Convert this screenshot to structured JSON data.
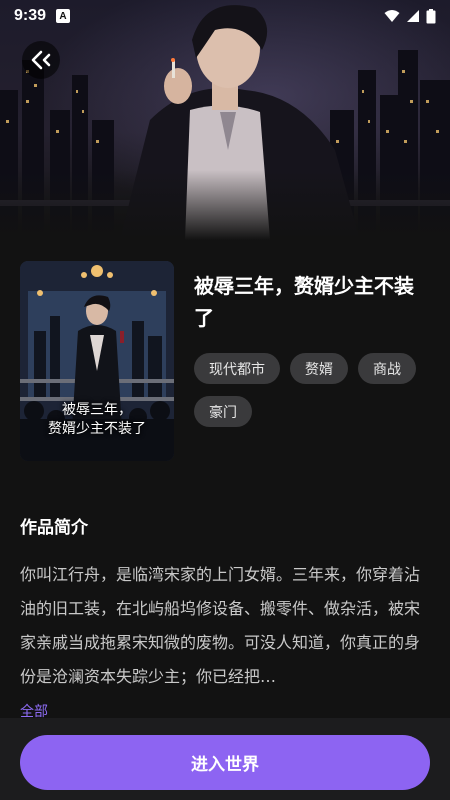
{
  "status_bar": {
    "time": "9:39",
    "notification_letter": "A",
    "icons": [
      "wifi-icon",
      "signal-icon",
      "battery-icon"
    ]
  },
  "header": {
    "back_icon": "back-arrow-icon"
  },
  "book": {
    "title": "被辱三年，赘婿少主不装了",
    "cover_text": [
      "被辱三年，",
      "赘婿少主不装了"
    ],
    "tags": [
      "现代都市",
      "赘婿",
      "商战",
      "豪门"
    ]
  },
  "intro": {
    "heading": "作品简介",
    "text": "你叫江行舟，是临湾宋家的上门女婿。三年来，你穿着沾油的旧工装，在北屿船坞修设备、搬零件、做杂活，被宋家亲戚当成拖累宋知微的废物。可没人知道，你真正的身份是沧澜资本失踪少主；你已经把…",
    "more_label": "全部"
  },
  "action": {
    "enter_label": "进入世界"
  },
  "colors": {
    "accent": "#8d64f2",
    "background": "#121212",
    "tag_bg": "#3a3a3c"
  }
}
